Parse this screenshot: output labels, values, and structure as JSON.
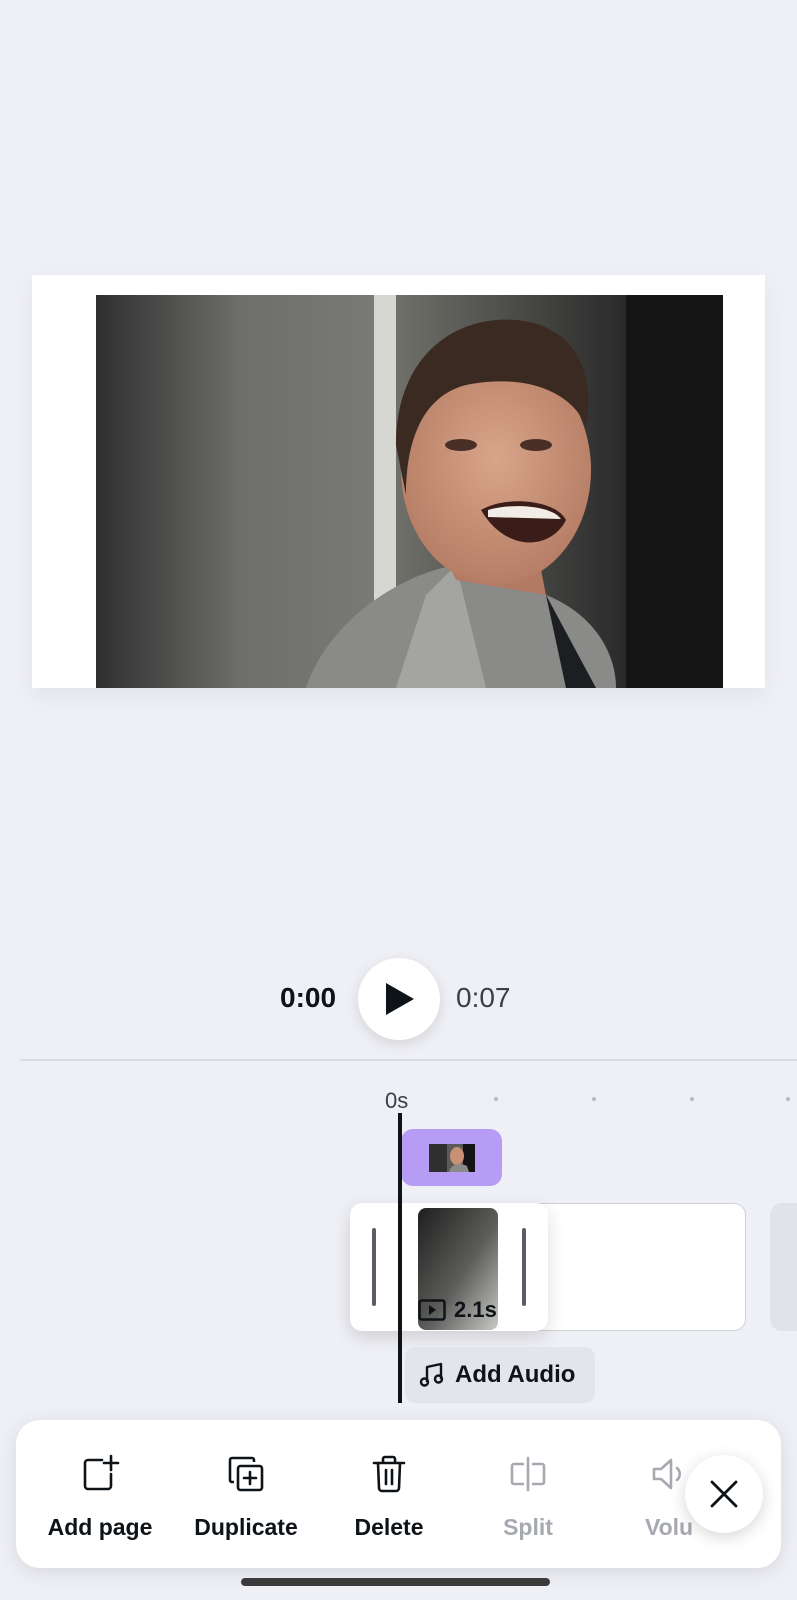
{
  "playback": {
    "current_time": "0:00",
    "total_time": "0:07"
  },
  "timeline": {
    "ruler_start_label": "0s",
    "clip_duration": "2.1s",
    "add_audio_label": "Add Audio"
  },
  "toolbar": {
    "items": [
      {
        "label": "Add page",
        "icon": "add-page-icon",
        "enabled": true
      },
      {
        "label": "Duplicate",
        "icon": "duplicate-icon",
        "enabled": true
      },
      {
        "label": "Delete",
        "icon": "trash-icon",
        "enabled": true
      },
      {
        "label": "Split",
        "icon": "split-icon",
        "enabled": false
      },
      {
        "label": "Volu",
        "icon": "volume-icon",
        "enabled": false
      }
    ],
    "close_icon": "close-icon"
  },
  "colors": {
    "background": "#eff0f5",
    "gif_chip": "#b79cf5",
    "text_primary": "#0e1318",
    "text_disabled": "#a6a9b0"
  }
}
